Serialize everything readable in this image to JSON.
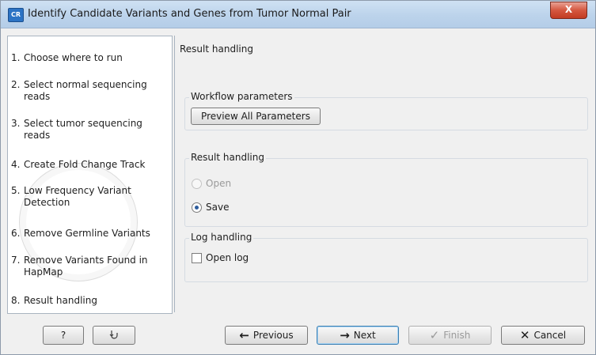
{
  "window": {
    "title": "Identify Candidate Variants and Genes from Tumor Normal Pair",
    "app_icon_text": "CR",
    "close_label": "X"
  },
  "steps": [
    {
      "number": "1.",
      "label": "Choose where to run"
    },
    {
      "number": "2.",
      "label": "Select normal sequencing reads"
    },
    {
      "number": "3.",
      "label": "Select tumor sequencing reads"
    },
    {
      "number": "4.",
      "label": "Create Fold Change Track"
    },
    {
      "number": "5.",
      "label": "Low Frequency Variant Detection"
    },
    {
      "number": "6.",
      "label": "Remove Germline Variants"
    },
    {
      "number": "7.",
      "label": "Remove Variants Found in HapMap"
    },
    {
      "number": "8.",
      "label": "Result handling"
    }
  ],
  "content": {
    "title": "Result handling",
    "workflow_parameters": {
      "legend": "Workflow parameters",
      "preview_button": "Preview All Parameters"
    },
    "result_handling": {
      "legend": "Result handling",
      "options": [
        {
          "label": "Open",
          "checked": false,
          "enabled": false
        },
        {
          "label": "Save",
          "checked": true,
          "enabled": true
        }
      ]
    },
    "log_handling": {
      "legend": "Log handling",
      "open_log_label": "Open log",
      "open_log_checked": false
    }
  },
  "footer": {
    "help_label": "?",
    "reset_icon": "undo-arrow-icon",
    "previous_label": "Previous",
    "next_label": "Next",
    "finish_label": "Finish",
    "cancel_label": "Cancel"
  }
}
